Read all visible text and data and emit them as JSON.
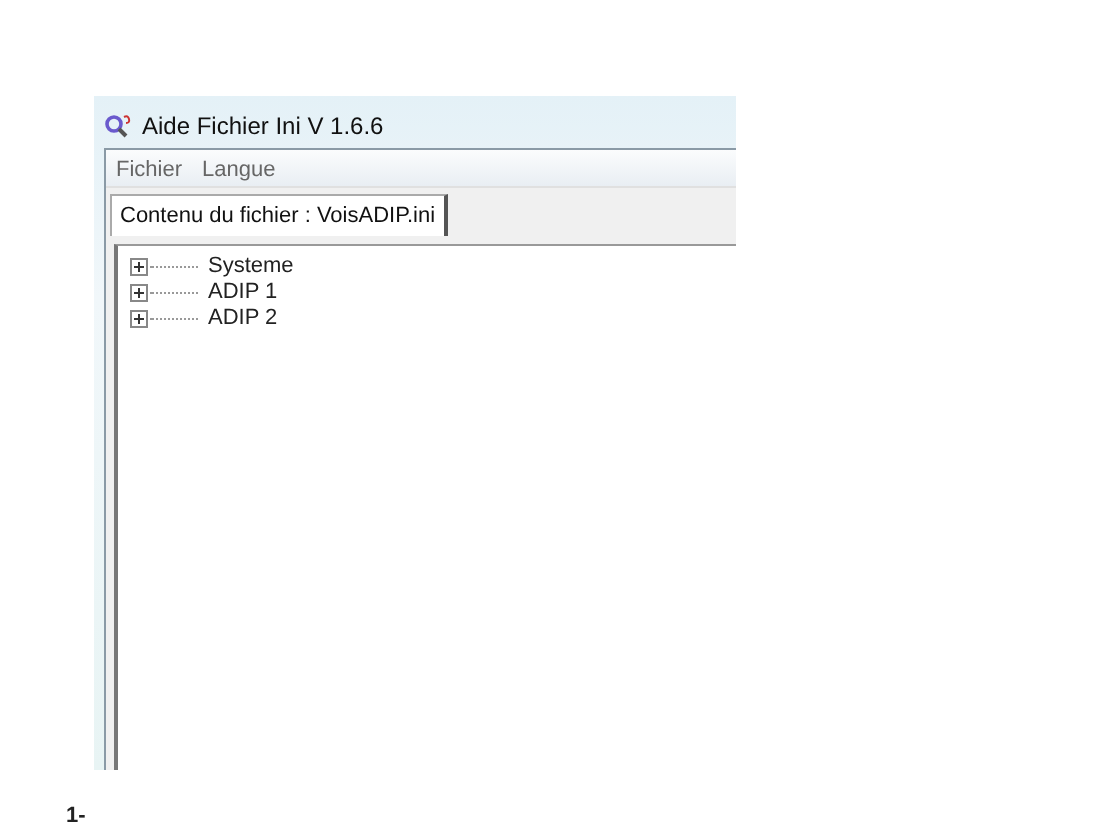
{
  "window": {
    "title": "Aide Fichier Ini  V 1.6.6"
  },
  "menu": [
    "Fichier",
    "Langue"
  ],
  "tabs": [
    {
      "label": "Contenu du fichier : VoisADIP.ini",
      "selected": true
    }
  ],
  "tree": [
    {
      "label": "Systeme",
      "expanded": false
    },
    {
      "label": "ADIP 1",
      "expanded": false
    },
    {
      "label": "ADIP 2",
      "expanded": false
    }
  ],
  "caption": "1-"
}
